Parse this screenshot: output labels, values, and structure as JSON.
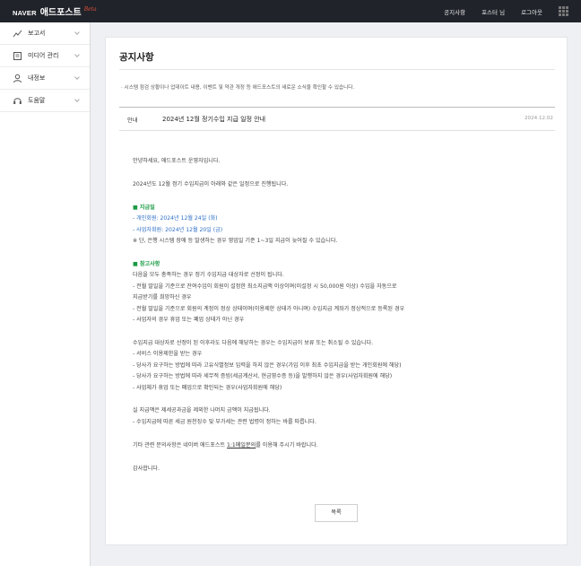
{
  "header": {
    "brand": "NAVER",
    "service": "애드포스트",
    "beta": "Beta",
    "nav": [
      "공지사항",
      "포스터 님",
      "로그아웃"
    ]
  },
  "sidebar": {
    "items": [
      {
        "label": "보고서",
        "icon": "chart-line-icon"
      },
      {
        "label": "미디어 관리",
        "icon": "media-icon"
      },
      {
        "label": "내정보",
        "icon": "person-icon"
      },
      {
        "label": "도움말",
        "icon": "headset-icon"
      }
    ]
  },
  "page": {
    "title": "공지사항",
    "description": "· 시스템 점검 상황이나 업데이트 내용, 이벤트 및 약관 개정 등 애드포스트의 새로운 소식을 확인할 수 있습니다."
  },
  "notice": {
    "category": "안내",
    "title": "2024년 12월 정기수입 지급 일정 안내",
    "date": "2024.12.02",
    "greeting": "안녕하세요, 애드포스트 운영자입니다.",
    "intro": "2024년도 12월 정기 수입지급이 아래와 같은 일정으로 진행됩니다.",
    "pay_head": "■ 지급일",
    "pay_1": "- 개인회원: 2024년 12월 24일 (화)",
    "pay_2": "- 사업자회원: 2024년 12월 20일 (금)",
    "pay_note": "※ 단, 은행 시스템 장애 등 발생하는 경우 영업일 기준 1~3일 지급이 늦어질 수 있습니다.",
    "ref_head": "■ 참고사항",
    "ref_intro": "다음을 모두 충족하는 경우 정기 수입지급 대상자로 선정이 됩니다.",
    "ref_1a": "- 전월 말일을 기준으로 잔여수입이 회원이 설정한 최소지급액 이상이며(미설정 시 50,000원 이상) 수입을 자동으로",
    "ref_1b": "지급받기를 희망하신 경우",
    "ref_2": "- 전월 말일을 기준으로 회원의 계정이 정상 상태이며(이용제한 상태가 아니며) 수입지급 계좌가 정상적으로 등록된 경우",
    "ref_3": "- 사업자의 경우 휴업 또는 폐업 상태가 아닌 경우",
    "excl_intro": "수입지급 대상자로 선정이 된 이후라도 다음에 해당하는 경우는 수입지급이 보류 또는 취소될 수 있습니다.",
    "excl_1": "- 서비스 이용제한을 받는 경우",
    "excl_2": "- 당사가 요구하는 방법에 따라 고유식별정보 입력을 하지 않은 경우(가입 이후 최초 수입지급을 받는 개인회원에 해당)",
    "excl_3": "- 당사가 요구하는 방법에 따라 세무적 증빙(세금계산서, 현금영수증 등)을 발행하지 않은 경우(사업자회원에 해당)",
    "excl_4": "- 사업체가 휴업 또는 폐업으로 확인되는 경우(사업자회원에 해당)",
    "tax_1": "실 지급액은 제세공과금을 제외한 나머지 금액이 지급됩니다.",
    "tax_2": "- 수입지급에 따른 세금 원천징수 및 부가세는 관련 법령이 정하는 바를 따릅니다.",
    "contact_pre": "기타 관련 문의사항은 네이버 애드포스트 ",
    "contact_link": "1:1메일문의",
    "contact_post": "를 이용해 주시기 바랍니다.",
    "closing": "감사합니다."
  },
  "list_button": "목록",
  "colors": {
    "topbar": "#20232a",
    "heading_green": "#1b9a45",
    "date_blue": "#2c6dc6",
    "beta_red": "#e0503a"
  }
}
